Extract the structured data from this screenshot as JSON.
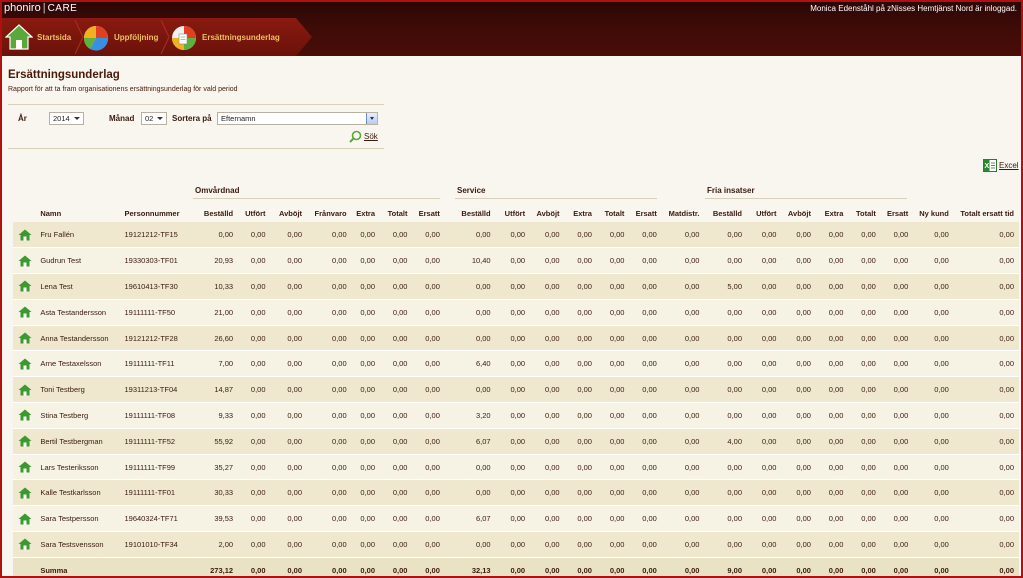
{
  "header": {
    "logo_text": "phoniro",
    "logo_sep": "|",
    "logo_care": "CARE",
    "user_info": "Monica Edenståhl på zNisses Hemtjänst Nord är inloggad."
  },
  "nav": {
    "items": [
      {
        "label": "Startsida",
        "icon": "home-icon"
      },
      {
        "label": "Uppföljning",
        "icon": "pie-chart-icon"
      },
      {
        "label": "Ersättningsunderlag",
        "icon": "report-chart-icon"
      }
    ]
  },
  "page": {
    "title": "Ersättningsunderlag",
    "subtitle": "Rapport för att ta fram organisationens ersättningsunderlag för vald period"
  },
  "filters": {
    "year_label": "År",
    "year_value": "2014",
    "month_label": "Månad",
    "month_value": "02",
    "sort_label": "Sortera på",
    "sort_value": "Efternamn",
    "search_label": "Sök"
  },
  "export": {
    "excel_label": "Excel"
  },
  "groups": {
    "omvardnad": "Omvårdnad",
    "service": "Service",
    "fria": "Fria insatser"
  },
  "columns": [
    "Namn",
    "Personnummer",
    "Beställd",
    "Utfört",
    "Avböjt",
    "Frånvaro",
    "Extra",
    "Totalt",
    "Ersatt",
    "Beställd",
    "Utfört",
    "Avböjt",
    "Extra",
    "Totalt",
    "Ersatt",
    "Matdistr.",
    "Beställd",
    "Utfört",
    "Avböjt",
    "Extra",
    "Totalt",
    "Ersatt",
    "Ny kund",
    "Totalt ersatt tid"
  ],
  "rows": [
    [
      "Fru Fallén",
      "19121212-TF15",
      "0,00",
      "0,00",
      "0,00",
      "0,00",
      "0,00",
      "0,00",
      "0,00",
      "0,00",
      "0,00",
      "0,00",
      "0,00",
      "0,00",
      "0,00",
      "0,00",
      "0,00",
      "0,00",
      "0,00",
      "0,00",
      "0,00",
      "0,00",
      "0,00",
      "0,00"
    ],
    [
      "Gudrun Test",
      "19330303-TF01",
      "20,93",
      "0,00",
      "0,00",
      "0,00",
      "0,00",
      "0,00",
      "0,00",
      "10,40",
      "0,00",
      "0,00",
      "0,00",
      "0,00",
      "0,00",
      "0,00",
      "0,00",
      "0,00",
      "0,00",
      "0,00",
      "0,00",
      "0,00",
      "0,00",
      "0,00"
    ],
    [
      "Lena Test",
      "19610413-TF30",
      "10,33",
      "0,00",
      "0,00",
      "0,00",
      "0,00",
      "0,00",
      "0,00",
      "0,00",
      "0,00",
      "0,00",
      "0,00",
      "0,00",
      "0,00",
      "0,00",
      "5,00",
      "0,00",
      "0,00",
      "0,00",
      "0,00",
      "0,00",
      "0,00",
      "0,00"
    ],
    [
      "Asta Testandersson",
      "19111111-TF50",
      "21,00",
      "0,00",
      "0,00",
      "0,00",
      "0,00",
      "0,00",
      "0,00",
      "0,00",
      "0,00",
      "0,00",
      "0,00",
      "0,00",
      "0,00",
      "0,00",
      "0,00",
      "0,00",
      "0,00",
      "0,00",
      "0,00",
      "0,00",
      "0,00",
      "0,00"
    ],
    [
      "Anna Testandersson",
      "19121212-TF28",
      "26,60",
      "0,00",
      "0,00",
      "0,00",
      "0,00",
      "0,00",
      "0,00",
      "0,00",
      "0,00",
      "0,00",
      "0,00",
      "0,00",
      "0,00",
      "0,00",
      "0,00",
      "0,00",
      "0,00",
      "0,00",
      "0,00",
      "0,00",
      "0,00",
      "0,00"
    ],
    [
      "Arne Testaxelsson",
      "19111111-TF11",
      "7,00",
      "0,00",
      "0,00",
      "0,00",
      "0,00",
      "0,00",
      "0,00",
      "6,40",
      "0,00",
      "0,00",
      "0,00",
      "0,00",
      "0,00",
      "0,00",
      "0,00",
      "0,00",
      "0,00",
      "0,00",
      "0,00",
      "0,00",
      "0,00",
      "0,00"
    ],
    [
      "Toni Testberg",
      "19311213-TF04",
      "14,87",
      "0,00",
      "0,00",
      "0,00",
      "0,00",
      "0,00",
      "0,00",
      "0,00",
      "0,00",
      "0,00",
      "0,00",
      "0,00",
      "0,00",
      "0,00",
      "0,00",
      "0,00",
      "0,00",
      "0,00",
      "0,00",
      "0,00",
      "0,00",
      "0,00"
    ],
    [
      "Stina Testberg",
      "19111111-TF08",
      "9,33",
      "0,00",
      "0,00",
      "0,00",
      "0,00",
      "0,00",
      "0,00",
      "3,20",
      "0,00",
      "0,00",
      "0,00",
      "0,00",
      "0,00",
      "0,00",
      "0,00",
      "0,00",
      "0,00",
      "0,00",
      "0,00",
      "0,00",
      "0,00",
      "0,00"
    ],
    [
      "Bertil Testbergman",
      "19111111-TF52",
      "55,92",
      "0,00",
      "0,00",
      "0,00",
      "0,00",
      "0,00",
      "0,00",
      "6,07",
      "0,00",
      "0,00",
      "0,00",
      "0,00",
      "0,00",
      "0,00",
      "4,00",
      "0,00",
      "0,00",
      "0,00",
      "0,00",
      "0,00",
      "0,00",
      "0,00"
    ],
    [
      "Lars Testeriksson",
      "19111111-TF99",
      "35,27",
      "0,00",
      "0,00",
      "0,00",
      "0,00",
      "0,00",
      "0,00",
      "0,00",
      "0,00",
      "0,00",
      "0,00",
      "0,00",
      "0,00",
      "0,00",
      "0,00",
      "0,00",
      "0,00",
      "0,00",
      "0,00",
      "0,00",
      "0,00",
      "0,00"
    ],
    [
      "Kalle Testkarlsson",
      "19111111-TF01",
      "30,33",
      "0,00",
      "0,00",
      "0,00",
      "0,00",
      "0,00",
      "0,00",
      "0,00",
      "0,00",
      "0,00",
      "0,00",
      "0,00",
      "0,00",
      "0,00",
      "0,00",
      "0,00",
      "0,00",
      "0,00",
      "0,00",
      "0,00",
      "0,00",
      "0,00"
    ],
    [
      "Sara Testpersson",
      "19640324-TF71",
      "39,53",
      "0,00",
      "0,00",
      "0,00",
      "0,00",
      "0,00",
      "0,00",
      "6,07",
      "0,00",
      "0,00",
      "0,00",
      "0,00",
      "0,00",
      "0,00",
      "0,00",
      "0,00",
      "0,00",
      "0,00",
      "0,00",
      "0,00",
      "0,00",
      "0,00"
    ],
    [
      "Sara Testsvensson",
      "19101010-TF34",
      "2,00",
      "0,00",
      "0,00",
      "0,00",
      "0,00",
      "0,00",
      "0,00",
      "0,00",
      "0,00",
      "0,00",
      "0,00",
      "0,00",
      "0,00",
      "0,00",
      "0,00",
      "0,00",
      "0,00",
      "0,00",
      "0,00",
      "0,00",
      "0,00",
      "0,00"
    ]
  ],
  "summary": [
    "Summa",
    "",
    "273,12",
    "0,00",
    "0,00",
    "0,00",
    "0,00",
    "0,00",
    "0,00",
    "32,13",
    "0,00",
    "0,00",
    "0,00",
    "0,00",
    "0,00",
    "0,00",
    "9,00",
    "0,00",
    "0,00",
    "0,00",
    "0,00",
    "0,00",
    "0,00",
    "0,00"
  ],
  "colors": {
    "header_bg": "#3d0b07",
    "nav_bg": "#7a160c",
    "nav_label": "#f0c060",
    "row_odd": "#efe8cf",
    "row_even": "#f6f2e4",
    "text": "#3a1a0e",
    "border": "#b01010"
  }
}
